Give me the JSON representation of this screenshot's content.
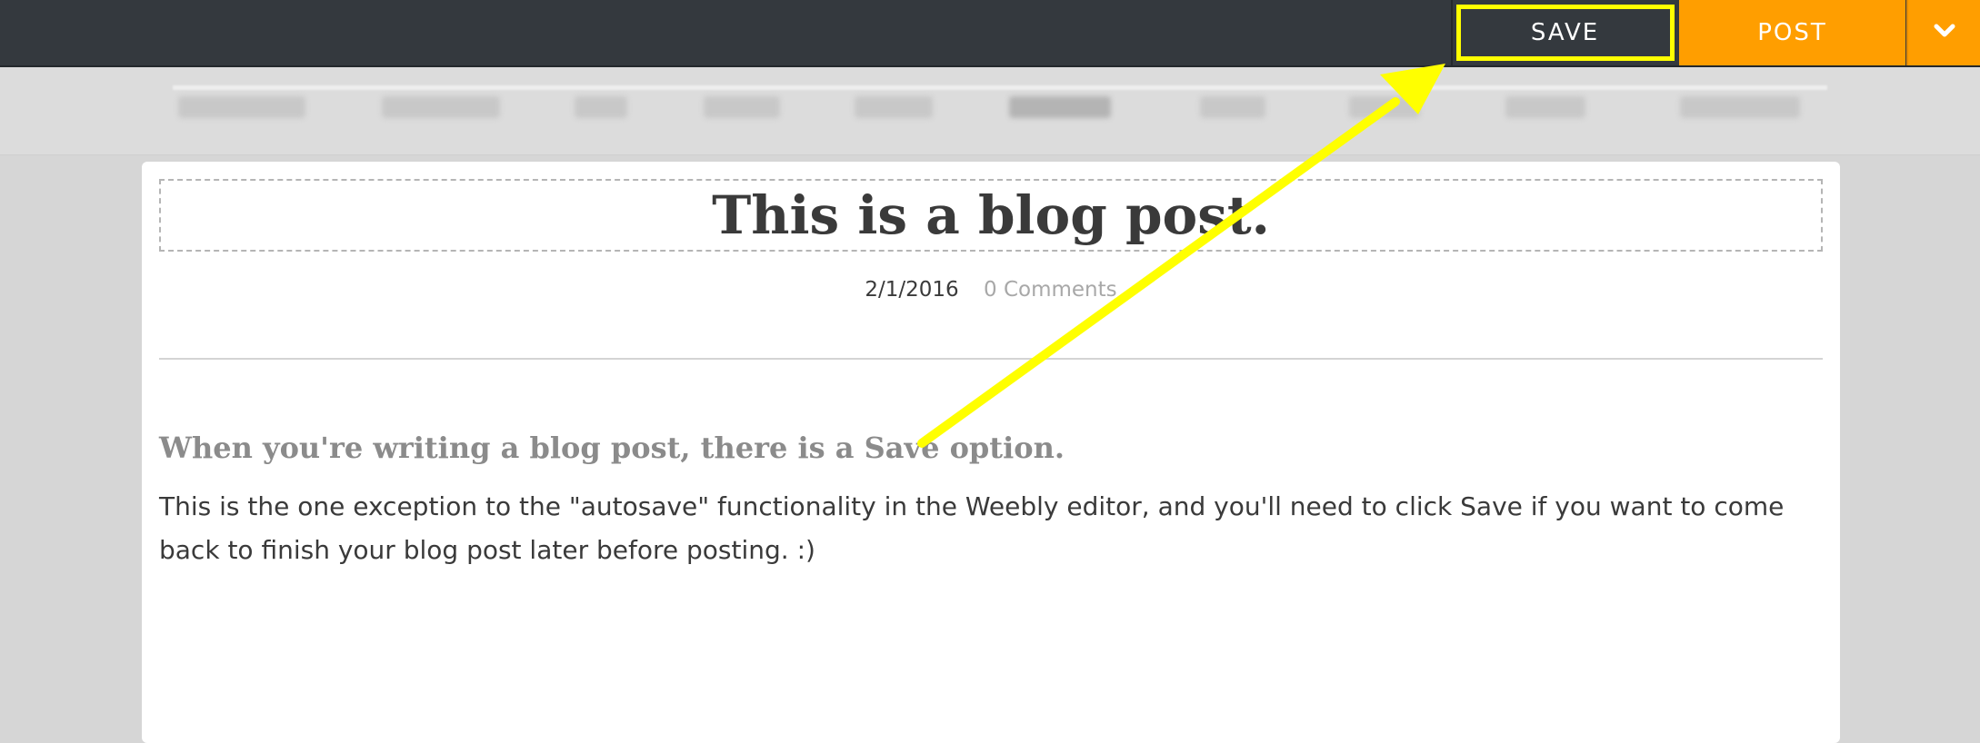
{
  "toolbar": {
    "save_label": "SAVE",
    "post_label": "POST",
    "dropdown_icon": "chevron-down-icon",
    "accent_color": "#ff9e00",
    "highlight_color": "#ffff00"
  },
  "post": {
    "title": "This is a blog post.",
    "date": "2/1/2016",
    "comments": "0 Comments",
    "subheading": "When you're writing a blog post, there is a Save option.",
    "body": "This is the one exception to the \"autosave\" functionality in the Weebly editor, and you'll need to click Save if you want to come back to finish your blog post later before posting. :)"
  },
  "annotation": {
    "type": "arrow",
    "color": "#ffff00",
    "points_to": "save-button"
  }
}
